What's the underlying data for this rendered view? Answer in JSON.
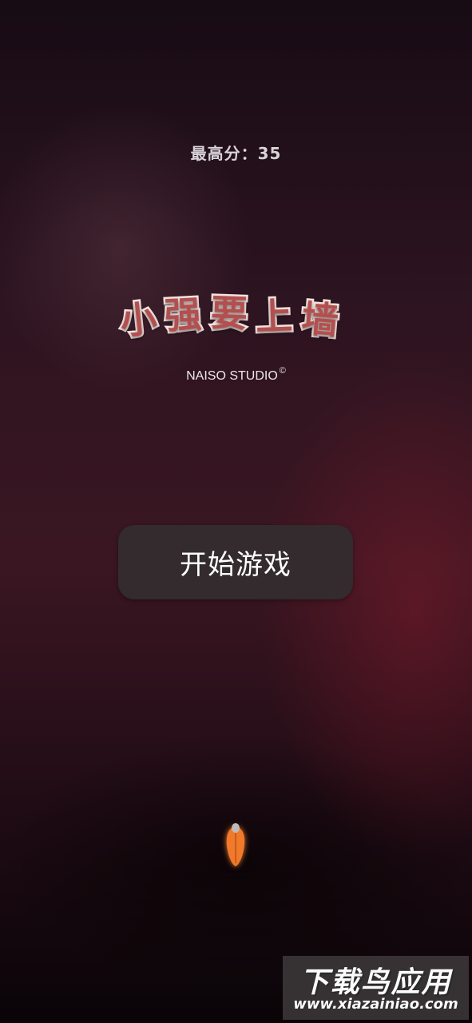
{
  "game": {
    "best_score_label": "最高分：",
    "best_score_value": "35",
    "title_chars": [
      "小",
      "强",
      "要",
      "上",
      "墙"
    ],
    "studio": "NAISO STUDIO",
    "copyright_mark": "©",
    "start_button_label": "开始游戏"
  },
  "player_icon": "roach-icon",
  "colors": {
    "title_fill": "#b44f4f",
    "title_outline": "#f4e6e2",
    "button_bg": "#332b2e",
    "player_orange": "#f07a2a"
  },
  "watermark": {
    "main": "下载鸟应用",
    "url": "www.xiazainiao.com"
  }
}
